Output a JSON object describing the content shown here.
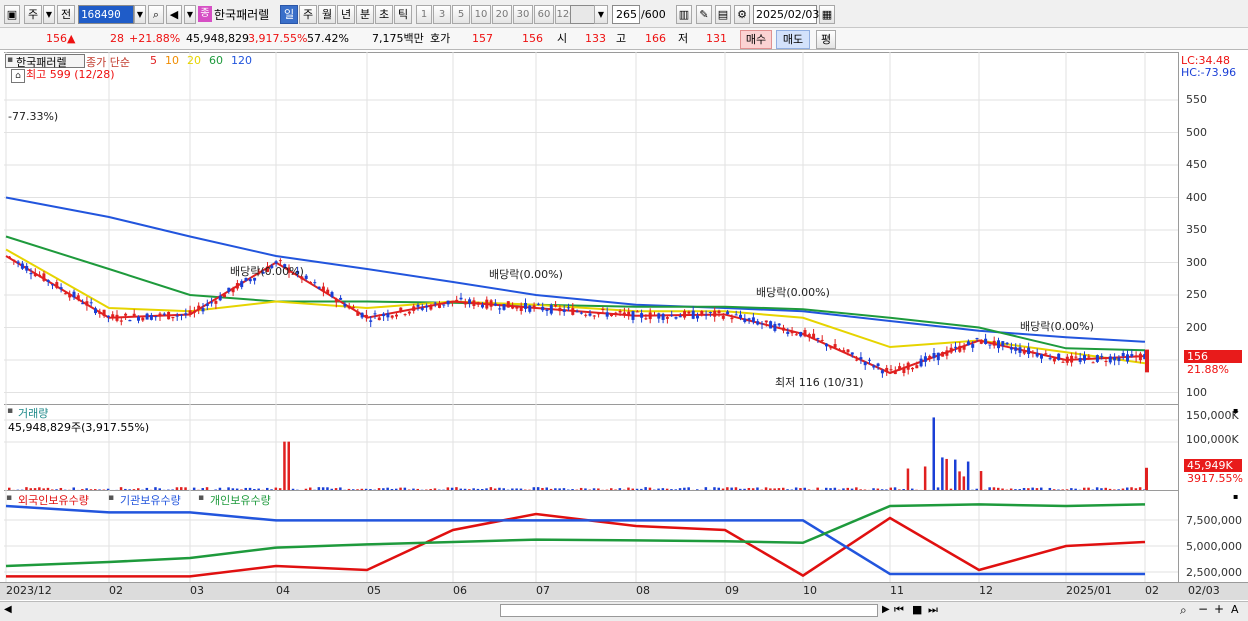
{
  "toolbar": {
    "market": "주",
    "prev": "전",
    "code": "168490",
    "badge": "종",
    "name": "한국패러렐",
    "periods": [
      "일",
      "주",
      "월",
      "년",
      "분",
      "초",
      "틱"
    ],
    "active_period": "일",
    "nums": [
      "1",
      "3",
      "5",
      "10",
      "20",
      "30",
      "60",
      "120"
    ],
    "count": "265",
    "total": "/600",
    "date": "2025/02/03"
  },
  "quote": {
    "price": "156",
    "arrow": "▲",
    "change": "28",
    "change_pct": "+21.88%",
    "volume": "45,948,829",
    "vol_ratio": "3,917.55%",
    "turnover": "57.42%",
    "amount": "7,175백만",
    "hoga_label": "호가",
    "ask": "157",
    "bid": "156",
    "open_label": "시",
    "open": "133",
    "high_label": "고",
    "high": "166",
    "low_label": "저",
    "low": "131",
    "buy_label": "매수",
    "sell_label": "매도",
    "avg_label": "평"
  },
  "price_pane": {
    "title": "한국패러렐",
    "series_label": "종가 단순",
    "ma": [
      {
        "label": "5",
        "color": "#e02020"
      },
      {
        "label": "10",
        "color": "#f08c00"
      },
      {
        "label": "20",
        "color": "#e6d400"
      },
      {
        "label": "60",
        "color": "#1e9a3c"
      },
      {
        "label": "120",
        "color": "#2255dd"
      }
    ],
    "high_note": "최고 599 (12/28)",
    "pct_note": "-77.33%)",
    "low_note": "최저 116 (10/31)",
    "dividend_notes": [
      "배당락(0.00%)",
      "배당락(0.00%)",
      "배당락(0.00%)",
      "배당락(0.00%)"
    ],
    "lc": "LC:34.48",
    "hc": "HC:-73.96",
    "ticks": [
      "550",
      "500",
      "450",
      "400",
      "350",
      "300",
      "250",
      "200",
      "150",
      "100"
    ],
    "current": "156",
    "current_pct": "21.88%"
  },
  "volume_pane": {
    "title": "거래량",
    "value": "45,948,829주(3,917.55%)",
    "ticks": [
      "150,000K",
      "100,000K"
    ],
    "current": "45,949K",
    "current_pct": "3917.55%"
  },
  "holding_pane": {
    "labels": [
      "외국인보유수량",
      "기관보유수량",
      "개인보유수량"
    ],
    "colors": [
      "#e01010",
      "#2255dd",
      "#1e9a3c"
    ],
    "ticks": [
      "7,500,000",
      "5,000,000",
      "2,500,000"
    ]
  },
  "x_axis": [
    "2023/12",
    "02",
    "03",
    "04",
    "05",
    "06",
    "07",
    "08",
    "09",
    "10",
    "11",
    "12",
    "2025/01",
    "02"
  ],
  "x_axis_right": "02/03",
  "chart_data": {
    "type": "line",
    "title": "한국패러렐",
    "x": [
      "2023/12",
      "02",
      "03",
      "04",
      "05",
      "06",
      "07",
      "08",
      "09",
      "10",
      "11",
      "12",
      "2025/01",
      "02"
    ],
    "ylim": [
      100,
      580
    ],
    "series": [
      {
        "name": "120",
        "values": [
          400,
          370,
          340,
          310,
          290,
          270,
          250,
          235,
          230,
          225,
          210,
          195,
          185,
          178
        ]
      },
      {
        "name": "60",
        "values": [
          340,
          290,
          250,
          240,
          240,
          238,
          235,
          232,
          232,
          228,
          215,
          200,
          168,
          165
        ]
      },
      {
        "name": "20",
        "values": [
          320,
          230,
          225,
          240,
          230,
          240,
          235,
          225,
          225,
          215,
          170,
          180,
          162,
          145
        ]
      },
      {
        "name": "5",
        "values": [
          310,
          215,
          220,
          300,
          215,
          240,
          230,
          218,
          220,
          190,
          130,
          180,
          150,
          156
        ]
      }
    ],
    "volume": {
      "ylim": [
        0,
        160000
      ],
      "unit": "K",
      "last": 45949
    },
    "holdings": {
      "ylim": [
        0,
        10000000
      ],
      "series": [
        {
          "name": "외국인보유수량",
          "values": [
            200000,
            200000,
            200000,
            1500000,
            1000000,
            6000000,
            8000000,
            6500000,
            6000000,
            300000,
            7500000,
            1000000,
            4000000,
            4500000
          ]
        },
        {
          "name": "기관보유수량",
          "values": [
            9000000,
            8200000,
            8200000,
            7200000,
            7200000,
            7200000,
            7200000,
            7200000,
            7200000,
            7200000,
            500000,
            500000,
            500000,
            500000
          ]
        },
        {
          "name": "개인보유수량",
          "values": [
            1500000,
            2000000,
            2500000,
            3800000,
            4200000,
            4500000,
            4800000,
            4700000,
            4600000,
            4400000,
            9000000,
            9200000,
            9000000,
            9200000
          ]
        }
      ]
    }
  }
}
